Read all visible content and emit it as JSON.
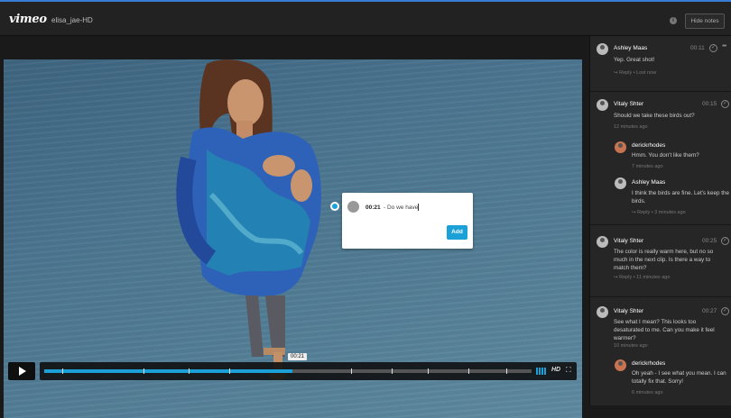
{
  "topbar": {
    "logo": "vimeo",
    "title": "elisa_jae-HD",
    "info_icon": "info-icon",
    "hide_notes": "Hide notes"
  },
  "player": {
    "progress_percent": 51,
    "current_time": "00:21",
    "hd_label": "HD",
    "fullscreen_glyph": "⛶"
  },
  "note_popup": {
    "timestamp": "00:21",
    "text": "- Do we have",
    "add_label": "Add"
  },
  "comments": [
    {
      "name": "Ashley Maas",
      "time": "00:11",
      "text": "Yep. Great shot!",
      "meta": "↪ Reply  •  Lost now"
    },
    {
      "name": "Vitaly Shter",
      "time": "00:15",
      "text": "Should we take these birds out?",
      "meta": "12 minutes ago",
      "replies": [
        {
          "name": "derickrhodes",
          "text": "Hmm. You don't like them?",
          "meta": "7 minutes ago"
        },
        {
          "name": "Ashley Maas",
          "text": "I think the birds are fine. Let's keep the birds.",
          "meta": "↪ Reply  •  3 minutes ago"
        }
      ]
    },
    {
      "name": "Vitaly Shter",
      "time": "00:25",
      "text": "The color is really warm here, but no so much in the next clip. Is there a way to match them?",
      "meta": "↪ Reply  •  11 minutes ago"
    },
    {
      "name": "Vitaly Shter",
      "time": "00:27",
      "text": "See what I mean? This looks too desaturated to me. Can you make it feel warmer?",
      "meta": "10 minutes ago",
      "replies": [
        {
          "name": "derickrhodes",
          "text": "Oh yeah - I see what you mean. I can totally fix that. Sorry!",
          "meta": "6 minutes ago"
        }
      ]
    }
  ]
}
